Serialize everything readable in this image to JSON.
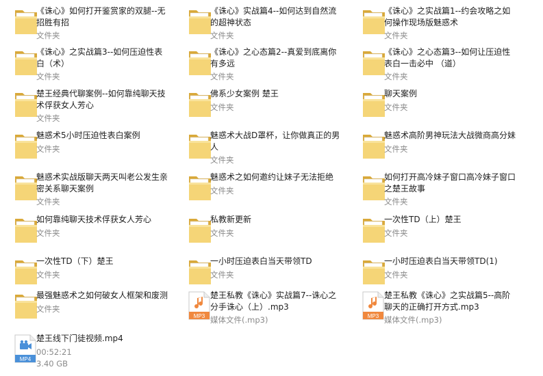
{
  "items": [
    {
      "name": "《诛心》如何打开鉴赏家的双腿--无招胜有招",
      "type": "文件夹",
      "icon": "folder-icon"
    },
    {
      "name": "《诛心》实战篇4--如何达到自然流的超神状态",
      "type": "文件夹",
      "icon": "folder-icon"
    },
    {
      "name": "《诛心》之实战篇1--约会攻略之如何操作现场版魅惑术",
      "type": "文件夹",
      "icon": "folder-icon"
    },
    {
      "name": "《诛心》之实战篇3--如何压迫性表白（术）",
      "type": "文件夹",
      "icon": "folder-icon"
    },
    {
      "name": "《诛心》之心态篇2--真爱到底离你有多远",
      "type": "文件夹",
      "icon": "folder-icon"
    },
    {
      "name": "《诛心》之心态篇3--如何让压迫性表白一击必中 （道）",
      "type": "文件夹",
      "icon": "folder-icon"
    },
    {
      "name": "楚王经典代聊案例--如何靠纯聊天技术俘获女人芳心",
      "type": "文件夹",
      "icon": "folder-icon"
    },
    {
      "name": "佛系少女案例 楚王",
      "type": "文件夹",
      "icon": "folder-icon"
    },
    {
      "name": "聊天案例",
      "type": "文件夹",
      "icon": "folder-icon"
    },
    {
      "name": "魅惑术5小时压迫性表白案例",
      "type": "文件夹",
      "icon": "folder-icon"
    },
    {
      "name": "魅惑术大战D罩杯，让你做真正的男人",
      "type": "文件夹",
      "icon": "folder-icon"
    },
    {
      "name": "魅惑术高阶男神玩法大战微商高分妹",
      "type": "文件夹",
      "icon": "folder-icon"
    },
    {
      "name": "魅惑术实战版聊天两天叫老公发生亲密关系聊天案例",
      "type": "文件夹",
      "icon": "folder-icon"
    },
    {
      "name": "魅惑术之如何邀约让妹子无法拒绝",
      "type": "文件夹",
      "icon": "folder-icon"
    },
    {
      "name": "如何打开高冷妹子窗口高冷妹子窗口之楚王故事",
      "type": "文件夹",
      "icon": "folder-icon"
    },
    {
      "name": "如何靠纯聊天技术俘获女人芳心",
      "type": "文件夹",
      "icon": "folder-icon"
    },
    {
      "name": "私教新更新",
      "type": "文件夹",
      "icon": "folder-icon"
    },
    {
      "name": "一次性TD（上）楚王",
      "type": "文件夹",
      "icon": "folder-icon"
    },
    {
      "name": "一次性TD（下）楚王",
      "type": "文件夹",
      "icon": "folder-icon"
    },
    {
      "name": "一小时压迫表白当天带领TD",
      "type": "文件夹",
      "icon": "folder-icon"
    },
    {
      "name": "一小时压迫表白当天带领TD(1)",
      "type": "文件夹",
      "icon": "folder-icon"
    },
    {
      "name": "最强魅惑术之如何破女人框架和废测",
      "type": "文件夹",
      "icon": "folder-icon"
    },
    {
      "name": "楚王私教《诛心》实战篇7--诛心之分手诛心（上）.mp3",
      "type": "媒体文件(.mp3)",
      "icon": "mp3-file-icon",
      "badge": "MP3"
    },
    {
      "name": "楚王私教《诛心》之实战篇5--高阶聊天的正确打开方式.mp3",
      "type": "媒体文件(.mp3)",
      "icon": "mp3-file-icon",
      "badge": "MP3"
    },
    {
      "name": "楚王线下门徒视频.mp4",
      "type": "00:52:21",
      "size": "3.40 GB",
      "icon": "mp4-file-icon",
      "badge": "MP4"
    }
  ],
  "colors": {
    "folder_back": "#e8c15a",
    "folder_front": "#f7d97a",
    "mp3": "#f0883e",
    "mp4": "#4a90d9",
    "meta": "#8a8a8a"
  }
}
